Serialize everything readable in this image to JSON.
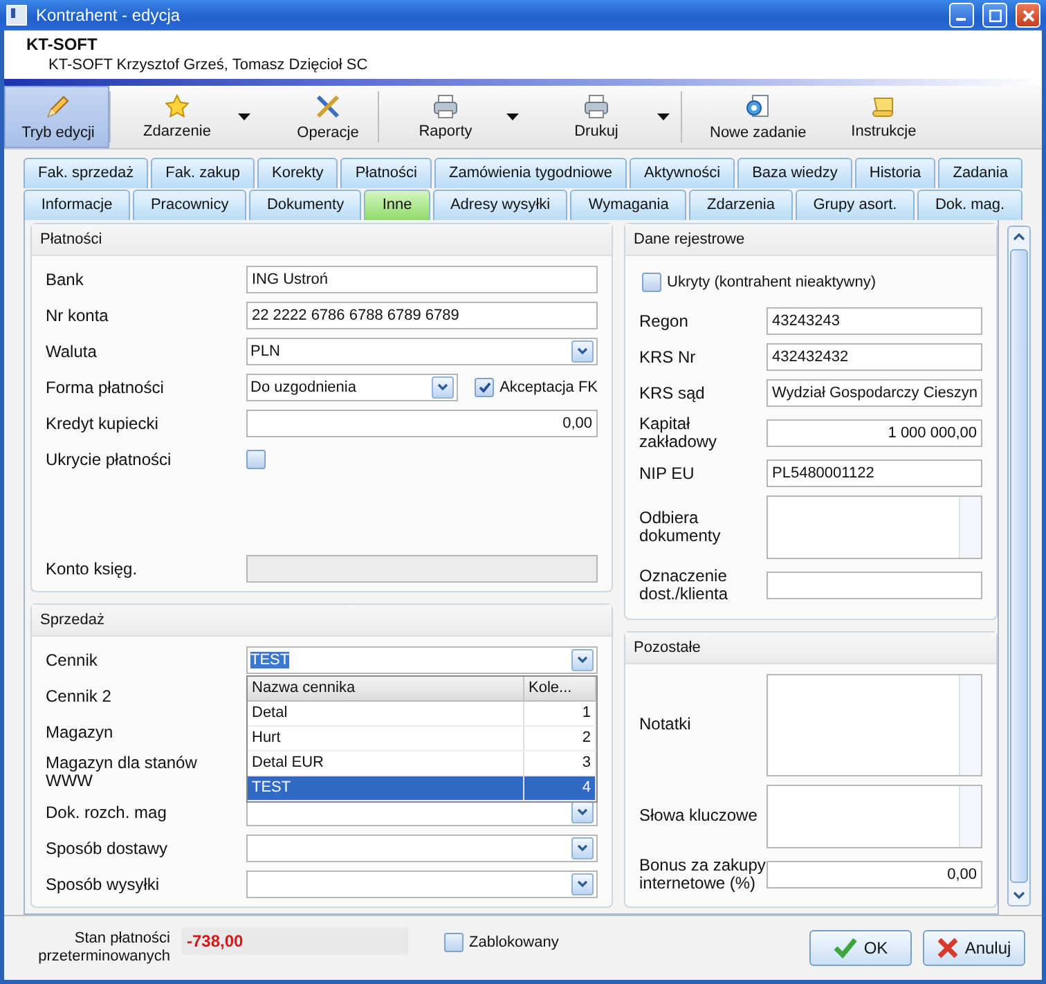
{
  "window": {
    "title": "Kontrahent - edycja"
  },
  "header": {
    "name": "KT-SOFT",
    "full_name": "KT-SOFT Krzysztof Grześ, Tomasz Dzięcioł SC"
  },
  "toolbar": [
    [
      {
        "label": "Tryb edycji",
        "selected": true,
        "has_menu": false
      }
    ],
    [
      {
        "label": "Zdarzenie",
        "selected": false,
        "has_menu": true
      },
      {
        "label": "Operacje",
        "selected": false,
        "has_menu": false
      }
    ],
    [
      {
        "label": "Raporty",
        "selected": false,
        "has_menu": true
      },
      {
        "label": "Drukuj",
        "selected": false,
        "has_menu": true
      }
    ],
    [
      {
        "label": "Nowe zadanie",
        "selected": false,
        "has_menu": false
      },
      {
        "label": "Instrukcje",
        "selected": false,
        "has_menu": false
      }
    ]
  ],
  "tabs": [
    [
      {
        "label": "Fak. sprzedaż",
        "selected": false
      },
      {
        "label": "Fak. zakup",
        "selected": false
      },
      {
        "label": "Korekty",
        "selected": false
      },
      {
        "label": "Płatności",
        "selected": false
      },
      {
        "label": "Zamówienia tygodniowe",
        "selected": false
      },
      {
        "label": "Aktywności",
        "selected": false
      },
      {
        "label": "Baza wiedzy",
        "selected": false
      },
      {
        "label": "Historia",
        "selected": false
      },
      {
        "label": "Zadania",
        "selected": false
      }
    ],
    [
      {
        "label": "Informacje",
        "selected": false
      },
      {
        "label": "Pracownicy",
        "selected": false
      },
      {
        "label": "Dokumenty",
        "selected": false
      },
      {
        "label": "Inne",
        "selected": true
      },
      {
        "label": "Adresy wysyłki",
        "selected": false
      },
      {
        "label": "Wymagania",
        "selected": false
      },
      {
        "label": "Zdarzenia",
        "selected": false
      },
      {
        "label": "Grupy asort.",
        "selected": false
      },
      {
        "label": "Dok. mag.",
        "selected": false
      }
    ]
  ],
  "left_panels": [
    {
      "title": "Płatności",
      "fields": [
        {
          "kind": "text",
          "label": "Bank",
          "value": "ING Ustroń"
        },
        {
          "kind": "text",
          "label": "Nr konta",
          "value": "22 2222 6786 6788 6789 6789"
        },
        {
          "kind": "combo",
          "label": "Waluta",
          "value": "PLN"
        },
        {
          "kind": "combo",
          "label": "Forma płatności",
          "value": "Do uzgodnienia",
          "extra_checkbox": {
            "label": "Akceptacja FK",
            "checked": true
          }
        },
        {
          "kind": "number",
          "label": "Kredyt kupiecki",
          "value": "0,00"
        },
        {
          "kind": "checkbox",
          "label": "Ukrycie płatności",
          "checked": false
        },
        {
          "kind": "readonly",
          "label": "Konto księg."
        }
      ]
    },
    {
      "title": "Sprzedaż",
      "fields": [
        {
          "kind": "combo",
          "label": "Cennik",
          "value": "TEST",
          "value_highlighted": true,
          "dropdown": {
            "columns": [
              "Nazwa cennika",
              "Kole..."
            ],
            "rows": [
              {
                "cells": [
                  "Detal",
                  "1"
                ],
                "selected": false
              },
              {
                "cells": [
                  "Hurt",
                  "2"
                ],
                "selected": false
              },
              {
                "cells": [
                  "Detal EUR",
                  "3"
                ],
                "selected": false
              },
              {
                "cells": [
                  "TEST",
                  "4"
                ],
                "selected": true
              }
            ]
          }
        },
        {
          "kind": "label",
          "label": "Cennik 2"
        },
        {
          "kind": "label",
          "label": "Magazyn"
        },
        {
          "kind": "label",
          "label": "Magazyn dla stanów WWW"
        },
        {
          "kind": "combo",
          "label": "Dok. rozch. mag"
        },
        {
          "kind": "combo",
          "label": "Sposób dostawy"
        },
        {
          "kind": "combo",
          "label": "Sposób wysyłki"
        }
      ]
    }
  ],
  "right_panels": [
    {
      "title": "Dane rejestrowe",
      "fields": [
        {
          "kind": "checkline",
          "label": "Ukryty (kontrahent nieaktywny)",
          "checked": false
        },
        {
          "kind": "text",
          "label": "Regon",
          "value": "43243243"
        },
        {
          "kind": "text",
          "label": "KRS Nr",
          "value": "432432432"
        },
        {
          "kind": "text",
          "label": "KRS sąd",
          "value": "Wydział Gospodarczy Cieszyn"
        },
        {
          "kind": "number",
          "label": "Kapitał zakładowy",
          "value": "1 000 000,00"
        },
        {
          "kind": "text",
          "label": "NIP EU",
          "value": "PL5480001122"
        },
        {
          "kind": "memo",
          "label": "Odbiera dokumenty"
        },
        {
          "kind": "text",
          "label": "Oznaczenie dost./klienta"
        }
      ]
    },
    {
      "title": "Pozostałe",
      "fields": [
        {
          "kind": "memo",
          "label": "Notatki",
          "tall": true
        },
        {
          "kind": "memo",
          "label": "Słowa kluczowe"
        },
        {
          "kind": "number",
          "label": "Bonus za zakupy internetowe (%)",
          "value": "0,00"
        }
      ]
    }
  ],
  "footer": {
    "overdue_label": "Stan płatności przeterminowanych",
    "overdue_value": "-738,00",
    "blocked": {
      "label": "Zablokowany",
      "checked": false
    },
    "buttons": [
      {
        "label": "OK"
      },
      {
        "label": "Anuluj"
      }
    ]
  }
}
